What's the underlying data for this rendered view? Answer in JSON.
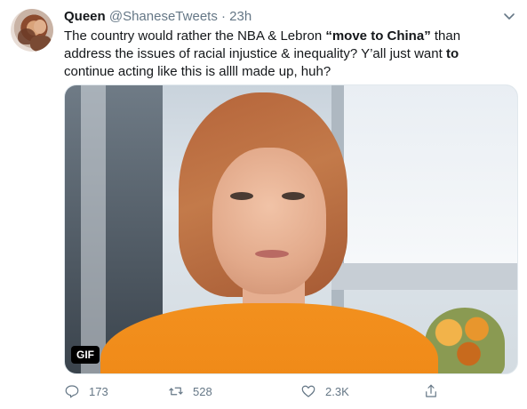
{
  "tweet": {
    "author": {
      "name": "Queen",
      "handle": "@ShaneseTweets",
      "separator": "·",
      "time": "23h"
    },
    "text": {
      "part1": "The country would rather the NBA & Lebron ",
      "quote_open": "“",
      "bold1": "move to China",
      "quote_close": "”",
      "part2": " than address the issues of racial injustice & inequality? Y’all just want ",
      "bold2": "to",
      "part3": " continue acting like this is allll made up, huh?"
    },
    "media": {
      "badge": "GIF"
    },
    "actions": {
      "reply_count": "173",
      "retweet_count": "528",
      "like_count": "2.3K"
    }
  },
  "icons": {
    "more": "chevron-down-icon",
    "reply": "reply-icon",
    "retweet": "retweet-icon",
    "like": "heart-icon",
    "share": "share-icon"
  },
  "colors": {
    "text": "#14171a",
    "muted": "#657786",
    "shirt": "#ef8614"
  }
}
